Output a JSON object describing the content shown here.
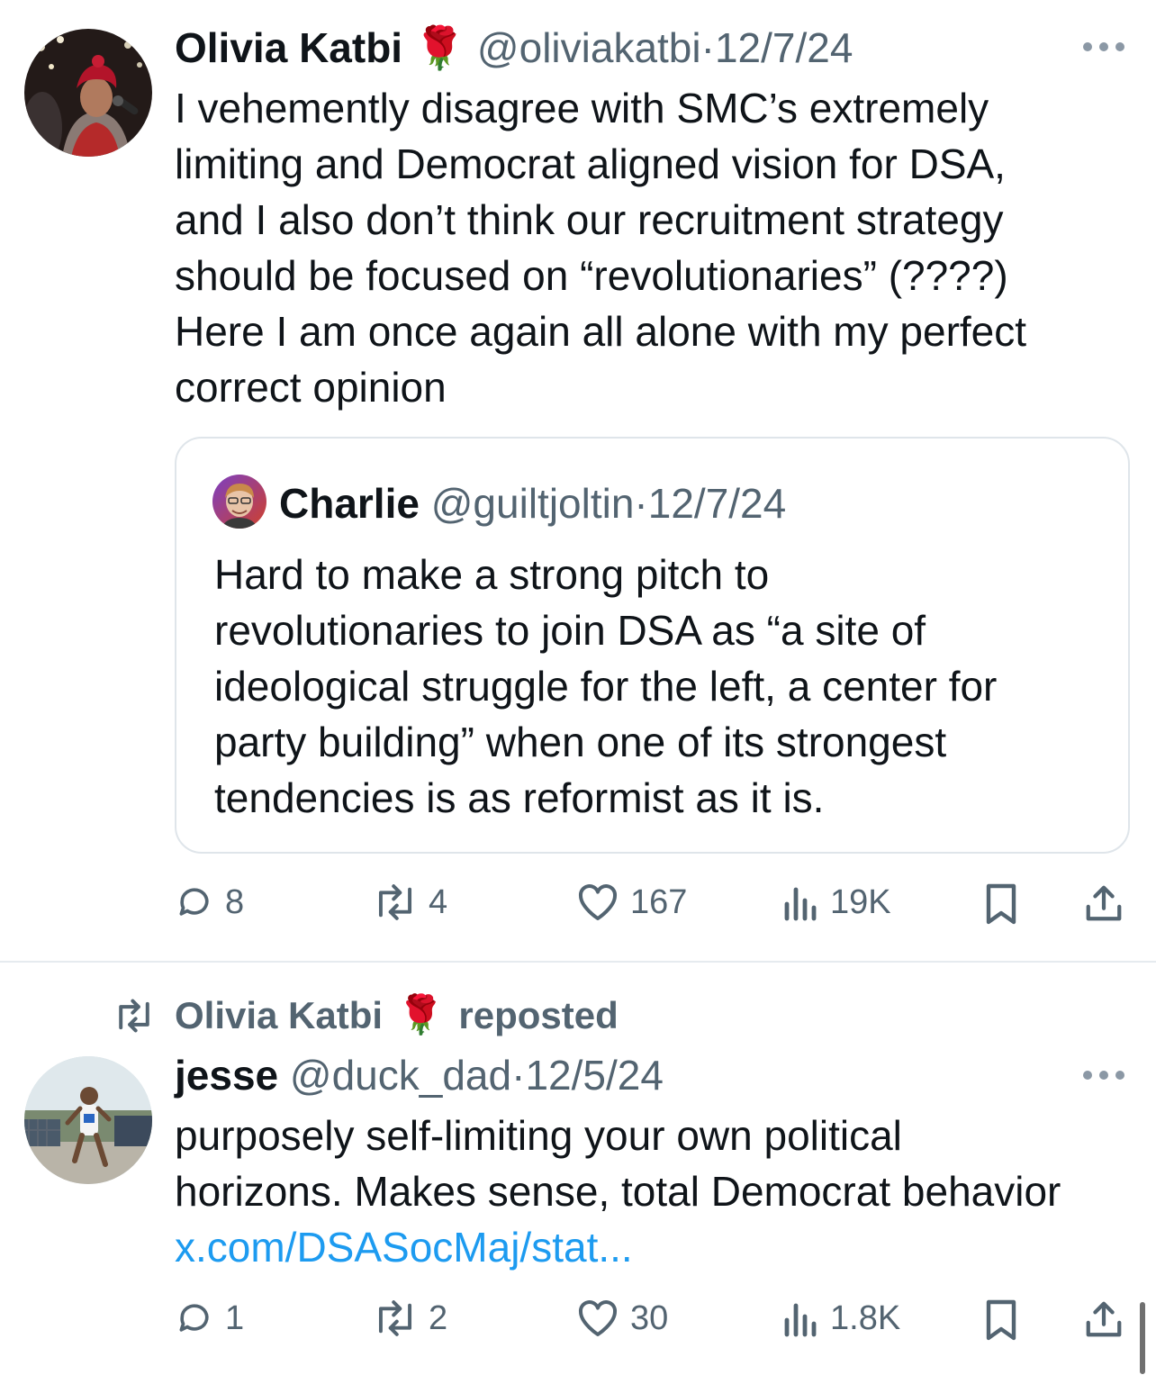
{
  "tweet1": {
    "author_name": "Olivia Katbi",
    "author_emoji": "🌹",
    "handle": "@oliviakatbi",
    "separator": "·",
    "date": "12/7/24",
    "body": [
      "I vehemently disagree with SMC’s extremely",
      "limiting and Democrat aligned vision for DSA,",
      "and I also don’t think our recruitment strategy",
      "should be focused on “revolutionaries” (????)",
      "Here I am once again all alone with my perfect",
      "correct opinion"
    ],
    "quote": {
      "author_name": "Charlie",
      "handle": "@guiltjoltin",
      "separator": "·",
      "date": "12/7/24",
      "body": [
        "Hard to make a strong pitch to",
        "revolutionaries to join DSA as “a site of",
        "ideological struggle for the left, a center for",
        "party building” when one of its strongest",
        "tendencies is as reformist as it is."
      ]
    },
    "actions": {
      "replies": "8",
      "reposts": "4",
      "likes": "167",
      "views": "19K"
    }
  },
  "repost_banner": {
    "reposter": "Olivia Katbi",
    "emoji": "🌹",
    "label": "reposted"
  },
  "tweet2": {
    "author_name": "jesse",
    "handle": "@duck_dad",
    "separator": "·",
    "date": "12/5/24",
    "body": [
      "purposely self-limiting your own political",
      "horizons. Makes sense, total Democrat behavior"
    ],
    "link": "x.com/DSASocMaj/stat...",
    "actions": {
      "replies": "1",
      "reposts": "2",
      "likes": "30",
      "views": "1.8K"
    }
  },
  "icons": {
    "reply": "reply-icon",
    "repost": "repost-icon",
    "like": "heart-icon",
    "views": "views-icon",
    "bookmark": "bookmark-icon",
    "share": "share-icon",
    "more": "more-icon"
  },
  "colors": {
    "text": "#0f1419",
    "secondary": "#536471",
    "link": "#1d9bf0",
    "rose": "#d0112b"
  }
}
